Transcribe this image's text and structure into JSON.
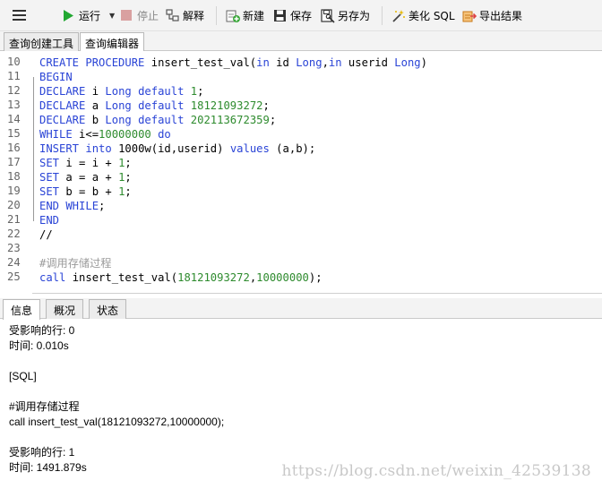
{
  "toolbar": {
    "run_label": "运行",
    "stop_label": "停止",
    "explain_label": "解释",
    "new_label": "新建",
    "save_label": "保存",
    "save_as_label": "另存为",
    "beautify_label": "美化 SQL",
    "export_label": "导出结果"
  },
  "editor_tabs": [
    "查询创建工具",
    "查询编辑器"
  ],
  "editor": {
    "lines": [
      {
        "n": "10",
        "parts": [
          [
            "kw",
            "CREATE PROCEDURE "
          ],
          [
            "txt",
            "insert_test_val("
          ],
          [
            "kw",
            "in"
          ],
          [
            "txt",
            " id "
          ],
          [
            "kw",
            "Long"
          ],
          [
            "txt",
            ","
          ],
          [
            "kw",
            "in"
          ],
          [
            "txt",
            " userid "
          ],
          [
            "kw",
            "Long"
          ],
          [
            "txt",
            ")"
          ]
        ]
      },
      {
        "n": "11",
        "parts": [
          [
            "kw",
            "BEGIN"
          ]
        ]
      },
      {
        "n": "12",
        "parts": [
          [
            "kw",
            "DECLARE"
          ],
          [
            "txt",
            " i "
          ],
          [
            "kw",
            "Long default "
          ],
          [
            "num",
            "1"
          ],
          [
            "txt",
            ";"
          ]
        ]
      },
      {
        "n": "13",
        "parts": [
          [
            "kw",
            "DECLARE"
          ],
          [
            "txt",
            " a "
          ],
          [
            "kw",
            "Long default "
          ],
          [
            "num",
            "18121093272"
          ],
          [
            "txt",
            ";"
          ]
        ]
      },
      {
        "n": "14",
        "parts": [
          [
            "kw",
            "DECLARE"
          ],
          [
            "txt",
            " b "
          ],
          [
            "kw",
            "Long default "
          ],
          [
            "num",
            "202113672359"
          ],
          [
            "txt",
            ";"
          ]
        ]
      },
      {
        "n": "15",
        "parts": [
          [
            "kw",
            "WHILE"
          ],
          [
            "txt",
            " i<="
          ],
          [
            "num",
            "10000000"
          ],
          [
            "kw",
            " do"
          ]
        ]
      },
      {
        "n": "16",
        "parts": [
          [
            "kw",
            "INSERT into "
          ],
          [
            "txt",
            "1000w(id,userid) "
          ],
          [
            "kw",
            "values"
          ],
          [
            "txt",
            " (a,b);"
          ]
        ]
      },
      {
        "n": "17",
        "parts": [
          [
            "kw",
            "SET"
          ],
          [
            "txt",
            " i = i + "
          ],
          [
            "num",
            "1"
          ],
          [
            "txt",
            ";"
          ]
        ]
      },
      {
        "n": "18",
        "parts": [
          [
            "kw",
            "SET"
          ],
          [
            "txt",
            " a = a + "
          ],
          [
            "num",
            "1"
          ],
          [
            "txt",
            ";"
          ]
        ]
      },
      {
        "n": "19",
        "parts": [
          [
            "kw",
            "SET"
          ],
          [
            "txt",
            " b = b + "
          ],
          [
            "num",
            "1"
          ],
          [
            "txt",
            ";"
          ]
        ]
      },
      {
        "n": "20",
        "parts": [
          [
            "kw",
            "END WHILE"
          ],
          [
            "txt",
            ";"
          ]
        ]
      },
      {
        "n": "21",
        "parts": [
          [
            "kw",
            "END"
          ]
        ]
      },
      {
        "n": "22",
        "parts": [
          [
            "txt",
            "//"
          ]
        ]
      },
      {
        "n": "23",
        "parts": []
      },
      {
        "n": "24",
        "parts": [
          [
            "cmt",
            "#调用存储过程"
          ]
        ]
      },
      {
        "n": "25",
        "parts": [
          [
            "kw",
            "call"
          ],
          [
            "txt",
            " insert_test_val("
          ],
          [
            "num",
            "18121093272"
          ],
          [
            "txt",
            ","
          ],
          [
            "num",
            "10000000"
          ],
          [
            "txt",
            ");"
          ]
        ]
      }
    ]
  },
  "result_tabs": [
    "信息",
    "概况",
    "状态"
  ],
  "output": {
    "lines": [
      "受影响的行: 0",
      "时间: 0.010s",
      "",
      "[SQL]",
      "",
      "#调用存储过程",
      "call insert_test_val(18121093272,10000000);",
      "",
      "受影响的行: 1",
      "时间: 1491.879s"
    ]
  },
  "watermark": "https://blog.csdn.net/weixin_42539138",
  "colors": {
    "keyword": "#2a44d6",
    "number": "#2e8b2e",
    "comment": "#9a9a9a",
    "run_icon": "#22a832",
    "stop_icon": "#d9a0a0"
  }
}
